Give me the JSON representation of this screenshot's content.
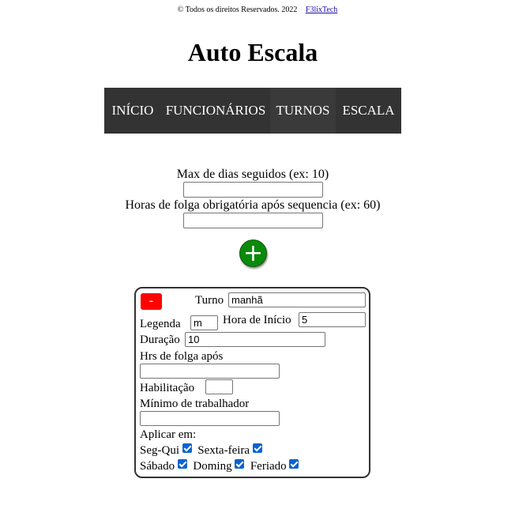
{
  "footer": {
    "copyright": "© Todos os direitos Reservados. 2022",
    "author_link": "F3lixTech"
  },
  "header": {
    "title": "Auto Escala"
  },
  "nav": {
    "items": [
      "INÍCIO",
      "FUNCIONÁRIOS",
      "TURNOS",
      "ESCALA"
    ]
  },
  "settings": {
    "max_days_label": "Max de dias seguidos (ex: 10)",
    "max_days_value": "",
    "rest_hours_label": "Horas de folga obrigatória após sequencia (ex: 60)",
    "rest_hours_value": ""
  },
  "add_button": {
    "label": "+"
  },
  "shift": {
    "remove_label": "-",
    "turno_label": "Turno",
    "turno_value": "manhã",
    "legenda_label": "Legenda",
    "legenda_value": "m",
    "hora_inicio_label": "Hora de Início",
    "hora_inicio_value": "5",
    "duracao_label": "Duração",
    "duracao_value": "10",
    "folga_label": "Hrs de folga após",
    "folga_value": "",
    "habilitacao_label": "Habilitação",
    "habilitacao_value": "",
    "minimo_label": "Mínimo de trabalhador",
    "minimo_value": "",
    "aplicar_label": "Aplicar em:",
    "days": {
      "seg_qui": "Seg-Qui",
      "sexta": "Sexta-feira",
      "sabado": "Sábado",
      "domingo": "Doming",
      "feriado": "Feriado"
    },
    "checked": {
      "seg_qui": true,
      "sexta": true,
      "sabado": true,
      "domingo": true,
      "feriado": true
    }
  },
  "colors": {
    "nav_bg": "#333333",
    "add_button": "#0a8a0a",
    "remove_button": "#ff0000",
    "checkbox": "#0b63ce"
  }
}
